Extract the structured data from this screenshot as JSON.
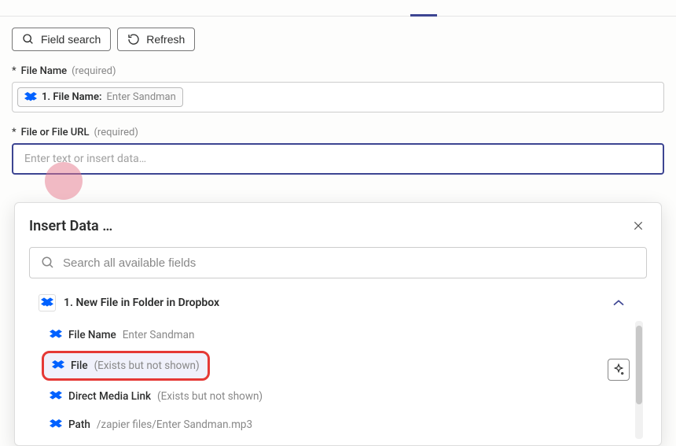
{
  "toolbar": {
    "field_search": "Field search",
    "refresh": "Refresh"
  },
  "fields": {
    "file_name": {
      "asterisk": "*",
      "label": "File Name",
      "note": "(required)",
      "pill_prefix": "1. File Name:",
      "pill_value": "Enter Sandman"
    },
    "file_url": {
      "asterisk": "*",
      "label": "File or File URL",
      "note": "(required)",
      "placeholder": "Enter text or insert data…"
    }
  },
  "popup": {
    "title": "Insert Data …",
    "search_placeholder": "Search all available fields",
    "source": {
      "label": "1. New File in Folder in Dropbox"
    },
    "items": [
      {
        "name": "File Name",
        "value": "Enter Sandman"
      },
      {
        "name": "File",
        "value": "(Exists but not shown)"
      },
      {
        "name": "Direct Media Link",
        "value": "(Exists but not shown)"
      },
      {
        "name": "Path",
        "value": "/zapier files/Enter Sandman.mp3"
      }
    ]
  }
}
